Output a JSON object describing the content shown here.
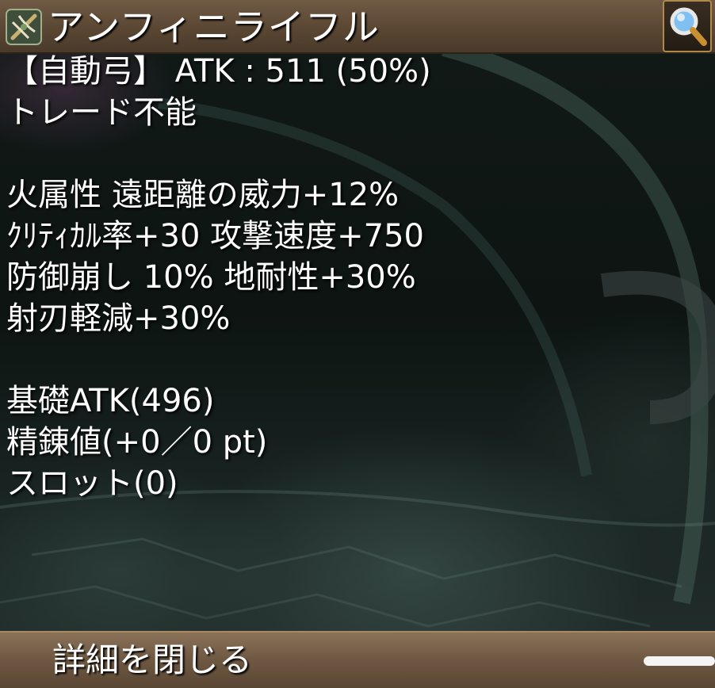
{
  "header": {
    "item_name": "アンフィニライフル",
    "icon": "crossbow-icon",
    "search_icon": "magnifier-icon"
  },
  "item": {
    "type_atk_line": "【自動弓】 ATK : 511 (50%)",
    "trade": "トレード不能",
    "options": [
      "火属性 遠距離の威力+12%",
      "ｸﾘﾃｨｶﾙ率+30 攻撃速度+750",
      "防御崩し 10% 地耐性+30%",
      "射刃軽減+30%"
    ],
    "base_atk": "基礎ATK(496)",
    "refine": "精錬値(+0／0 pt)",
    "slot": "スロット(0)"
  },
  "footer": {
    "close_label": "詳細を閉じる",
    "menu_icon": "menu-handle-icon"
  },
  "colors": {
    "panel_brown": "#5a4733",
    "footer_brown": "#6e5842",
    "text": "#ffffff",
    "search_border": "#b08a4a"
  }
}
